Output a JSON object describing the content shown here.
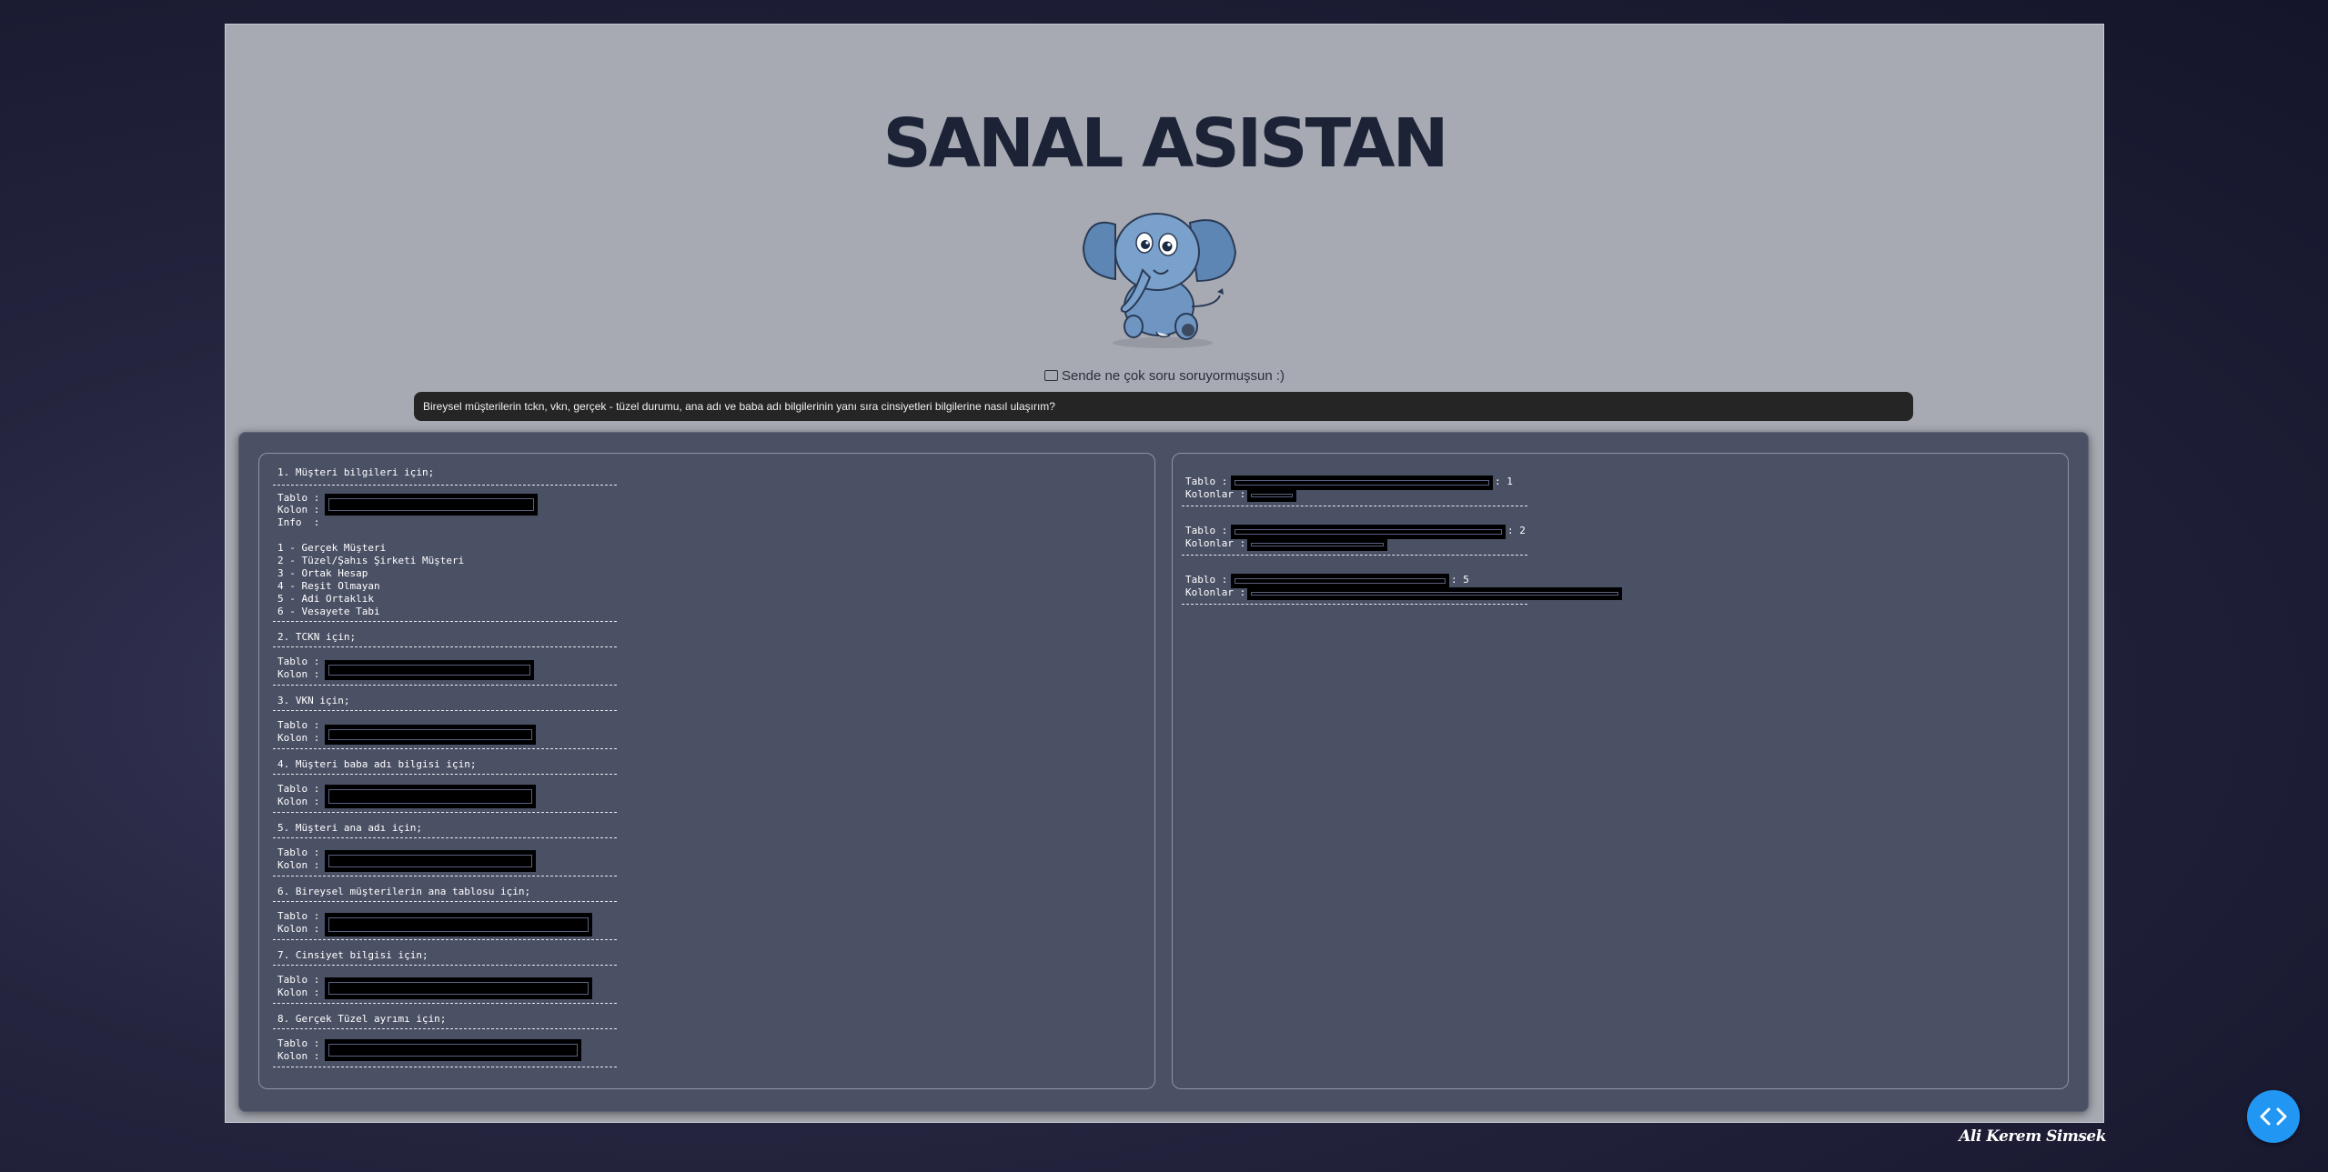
{
  "header": {
    "title": "SANAL ASISTAN"
  },
  "subtitle": "Sende ne çok soru soruyormuşsun :)",
  "query": "Bireysel müşterilerin tckn, vkn, gerçek - tüzel durumu, ana adı ve baba adı bilgilerinin yanı sıra cinsiyetleri bilgilerine nasıl ulaşırım?",
  "left_panel": {
    "sections": [
      {
        "heading": "1. Müşteri bilgileri için;",
        "lines": [
          "Tablo :",
          "Kolon :",
          "Info  :"
        ]
      },
      {
        "heading": "2. TCKN için;",
        "lines": [
          "Tablo :",
          "Kolon :"
        ]
      },
      {
        "heading": "3. VKN için;",
        "lines": [
          "Tablo :",
          "Kolon :"
        ]
      },
      {
        "heading": "4. Müşteri baba adı bilgisi için;",
        "lines": [
          "Tablo :",
          "Kolon :"
        ]
      },
      {
        "heading": "5. Müşteri ana adı için;",
        "lines": [
          "Tablo :",
          "Kolon :"
        ]
      },
      {
        "heading": "6. Bireysel müşterilerin ana tablosu için;",
        "lines": [
          "Tablo :",
          "Kolon :"
        ]
      },
      {
        "heading": "7. Cinsiyet bilgisi için;",
        "lines": [
          "Tablo :",
          "Kolon :"
        ]
      },
      {
        "heading": "8. Gerçek Tüzel ayrımı için;",
        "lines": [
          "Tablo :",
          "Kolon :"
        ]
      }
    ],
    "info_list": [
      "1 - Gerçek Müşteri",
      "2 - Tüzel/Şahıs Şirketi Müşteri",
      "3 - Ortak Hesap",
      "4 - Reşit Olmayan",
      "5 - Adi Ortaklık",
      "6 - Vesayete Tabi"
    ]
  },
  "right_panel": {
    "blocks": [
      {
        "tablo_label": "Tablo :",
        "suffix": ": 1",
        "kolon_label": "Kolonlar :"
      },
      {
        "tablo_label": "Tablo :",
        "suffix": ": 2",
        "kolon_label": "Kolonlar :"
      },
      {
        "tablo_label": "Tablo :",
        "suffix": ": 5",
        "kolon_label": "Kolonlar :"
      }
    ]
  },
  "footer": "Ali Kerem Simsek",
  "colors": {
    "accent": "#2196f3",
    "frame_bg": "#a8aab3",
    "results_bg": "#4b5165",
    "title": "#1c2336"
  },
  "icons": {
    "chat": "chat-bubble-icon",
    "code": "code-icon"
  }
}
